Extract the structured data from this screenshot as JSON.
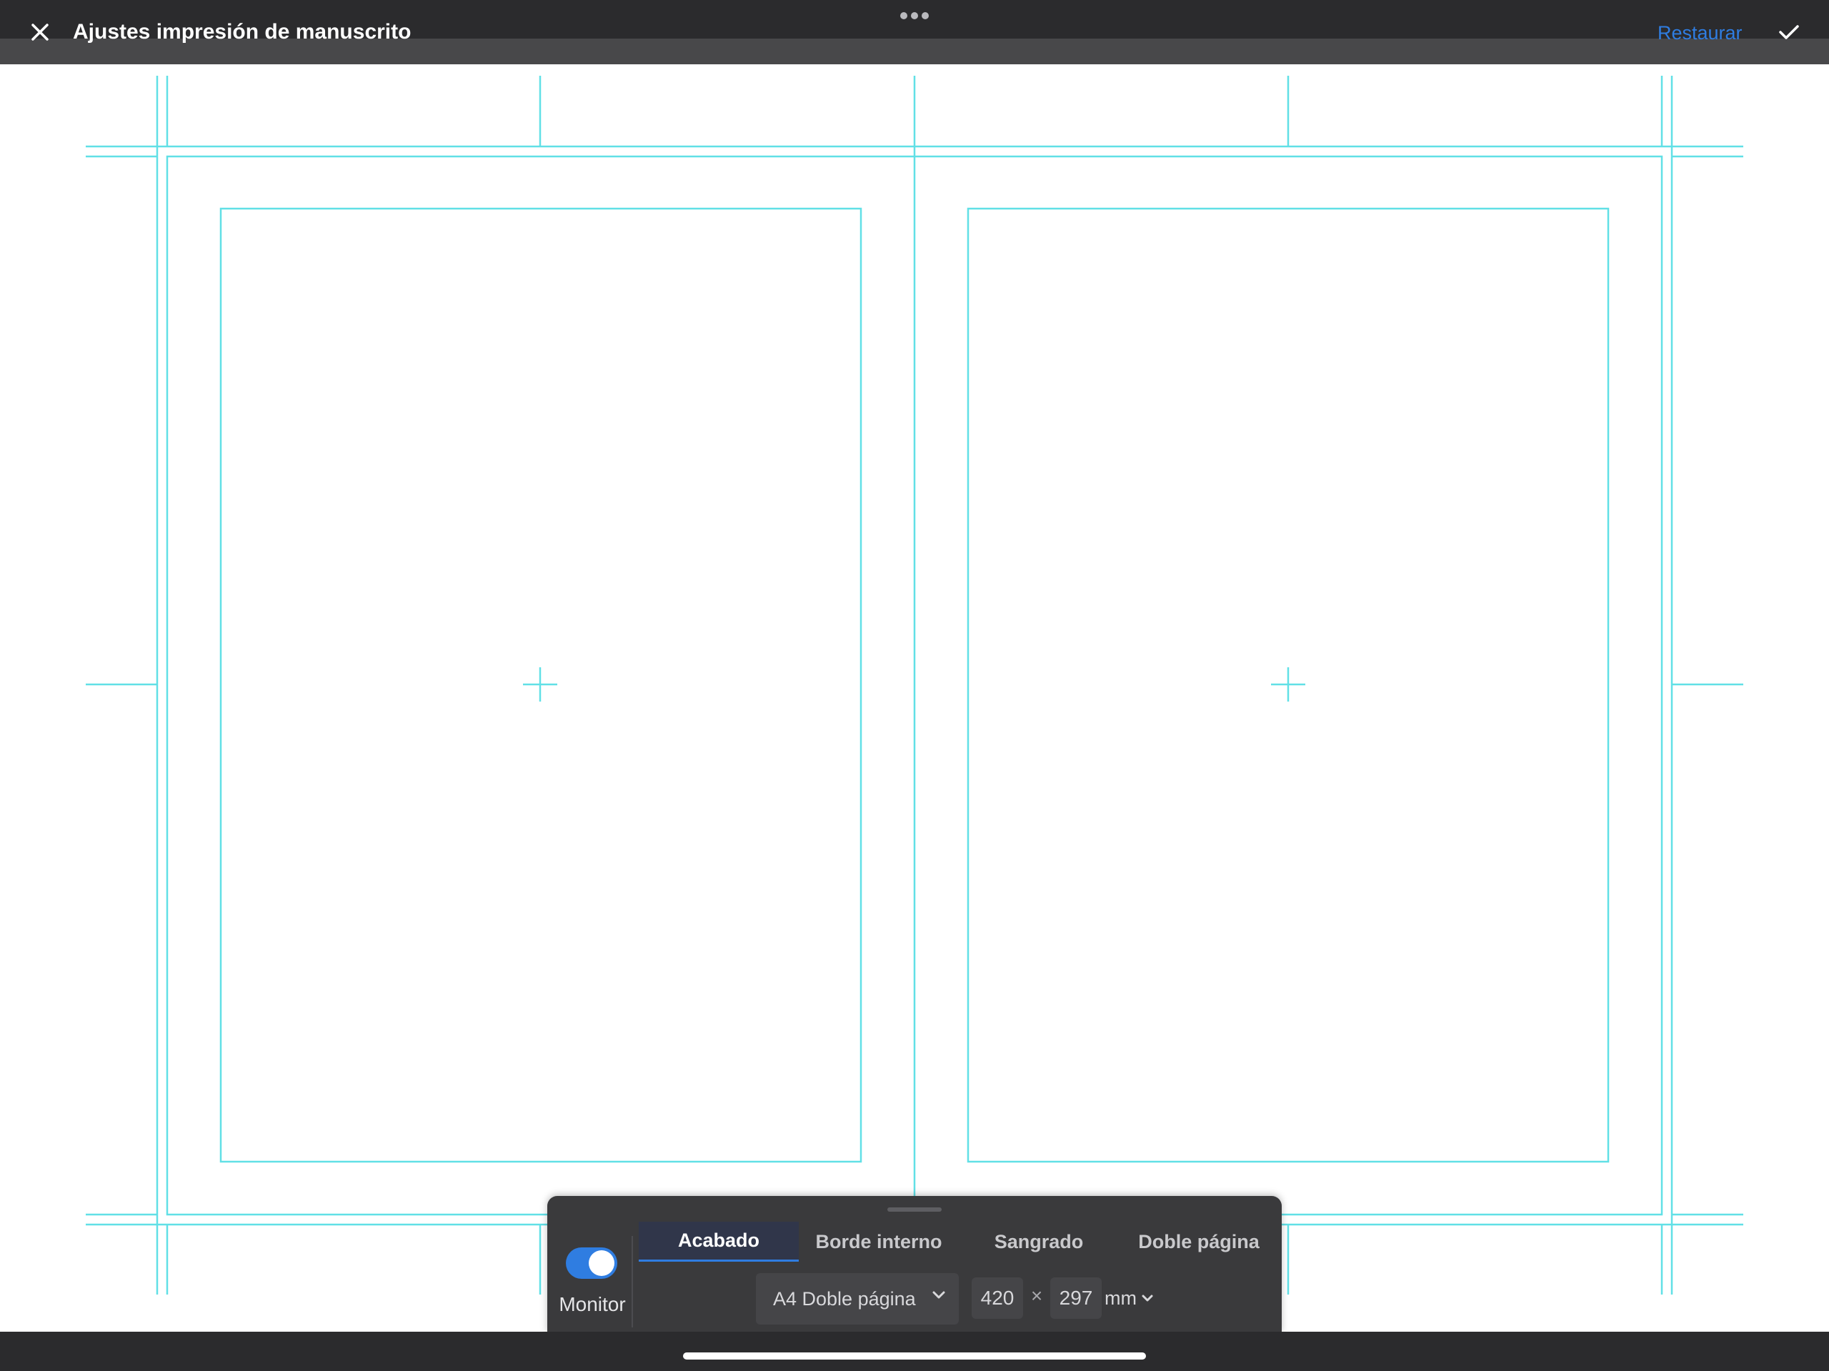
{
  "header": {
    "title": "Ajustes impresión de manuscrito",
    "restore_label": "Restaurar",
    "close_icon": "close-icon",
    "more_icon": "more-horizontal-icon",
    "confirm_icon": "checkmark-icon"
  },
  "colors": {
    "guide_lines": "#61e0e6",
    "accent": "#2f7de1",
    "bar_background": "#2b2b2d",
    "panel_background": "#3a3a3c"
  },
  "panel": {
    "monitor_label": "Monitor",
    "monitor_enabled": true,
    "tabs": [
      {
        "label": "Acabado",
        "active": true
      },
      {
        "label": "Borde interno",
        "active": false
      },
      {
        "label": "Sangrado",
        "active": false
      },
      {
        "label": "Doble página",
        "active": false
      }
    ],
    "preset": "A4 Doble página",
    "width": "420",
    "times": "×",
    "height": "297",
    "unit": "mm"
  }
}
